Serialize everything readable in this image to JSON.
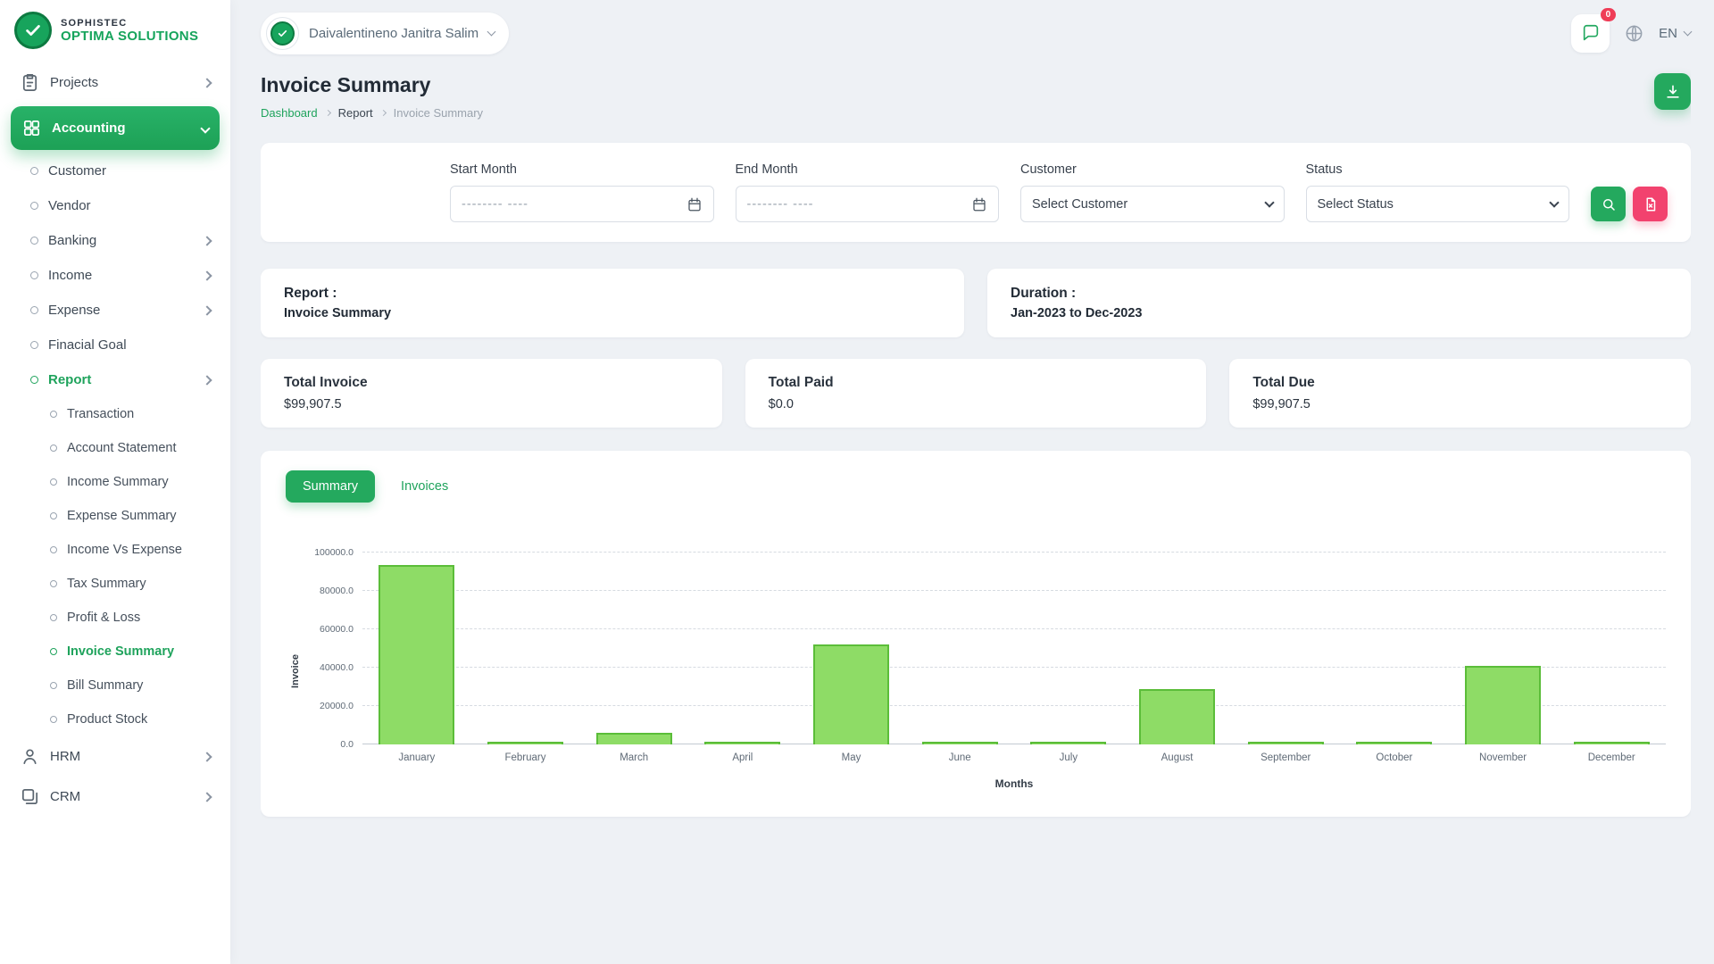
{
  "brand": {
    "line1": "SOPHISTEC",
    "line2": "OPTIMA SOLUTIONS"
  },
  "header": {
    "user_name": "Daivalentineno Janitra Salim",
    "messages_badge": "0",
    "language": "EN"
  },
  "sidebar": {
    "items": [
      {
        "label": "Projects",
        "level": "top",
        "icon": "clipboard-icon",
        "chevron": "right"
      },
      {
        "label": "Accounting",
        "level": "top",
        "icon": "grid-icon",
        "chevron": "down",
        "active": true
      },
      {
        "label": "Customer",
        "level": "mid"
      },
      {
        "label": "Vendor",
        "level": "mid"
      },
      {
        "label": "Banking",
        "level": "mid",
        "chevron": "right"
      },
      {
        "label": "Income",
        "level": "mid",
        "chevron": "right"
      },
      {
        "label": "Expense",
        "level": "mid",
        "chevron": "right"
      },
      {
        "label": "Finacial Goal",
        "level": "mid"
      },
      {
        "label": "Report",
        "level": "mid",
        "chevron": "right",
        "open": true
      },
      {
        "label": "Transaction",
        "level": "sub"
      },
      {
        "label": "Account Statement",
        "level": "sub"
      },
      {
        "label": "Income Summary",
        "level": "sub"
      },
      {
        "label": "Expense Summary",
        "level": "sub"
      },
      {
        "label": "Income Vs Expense",
        "level": "sub"
      },
      {
        "label": "Tax Summary",
        "level": "sub"
      },
      {
        "label": "Profit & Loss",
        "level": "sub"
      },
      {
        "label": "Invoice Summary",
        "level": "sub",
        "active": true
      },
      {
        "label": "Bill Summary",
        "level": "sub"
      },
      {
        "label": "Product Stock",
        "level": "sub"
      },
      {
        "label": "HRM",
        "level": "top",
        "icon": "people-icon",
        "chevron": "right"
      },
      {
        "label": "CRM",
        "level": "top",
        "icon": "layers-icon",
        "chevron": "right"
      }
    ]
  },
  "page": {
    "title": "Invoice Summary",
    "breadcrumb": [
      {
        "label": "Dashboard"
      },
      {
        "label": "Report"
      },
      {
        "label": "Invoice Summary"
      }
    ]
  },
  "filters": {
    "start_month": {
      "label": "Start Month",
      "placeholder": "-------- ----"
    },
    "end_month": {
      "label": "End Month",
      "placeholder": "-------- ----"
    },
    "customer": {
      "label": "Customer",
      "value": "Select Customer"
    },
    "status": {
      "label": "Status",
      "value": "Select Status"
    }
  },
  "summary_cards": {
    "report": {
      "label": "Report :",
      "value": "Invoice Summary"
    },
    "duration": {
      "label": "Duration :",
      "value": "Jan-2023 to Dec-2023"
    }
  },
  "stats": [
    {
      "label": "Total Invoice",
      "value": "$99,907.5"
    },
    {
      "label": "Total Paid",
      "value": "$0.0"
    },
    {
      "label": "Total Due",
      "value": "$99,907.5"
    }
  ],
  "tabs": [
    {
      "label": "Summary",
      "active": true
    },
    {
      "label": "Invoices",
      "active": false
    }
  ],
  "chart_data": {
    "type": "bar",
    "title": "",
    "xlabel": "Months",
    "ylabel": "Invoice",
    "categories": [
      "January",
      "February",
      "March",
      "April",
      "May",
      "June",
      "July",
      "August",
      "September",
      "October",
      "November",
      "December"
    ],
    "values": [
      93500,
      1200,
      6000,
      900,
      52000,
      900,
      800,
      29000,
      600,
      500,
      41000,
      700
    ],
    "ylim": [
      0,
      100000
    ],
    "yticks": [
      0,
      20000,
      40000,
      60000,
      80000,
      100000
    ],
    "ytick_labels": [
      "0.0",
      "20000.0",
      "40000.0",
      "60000.0",
      "80000.0",
      "100000.0"
    ],
    "grid": "dashed-horizontal",
    "legend": "none",
    "bar_color": "#8edc66",
    "bar_border": "#5bbd39"
  },
  "colors": {
    "primary": "#24a95e",
    "danger": "#f2426e"
  }
}
